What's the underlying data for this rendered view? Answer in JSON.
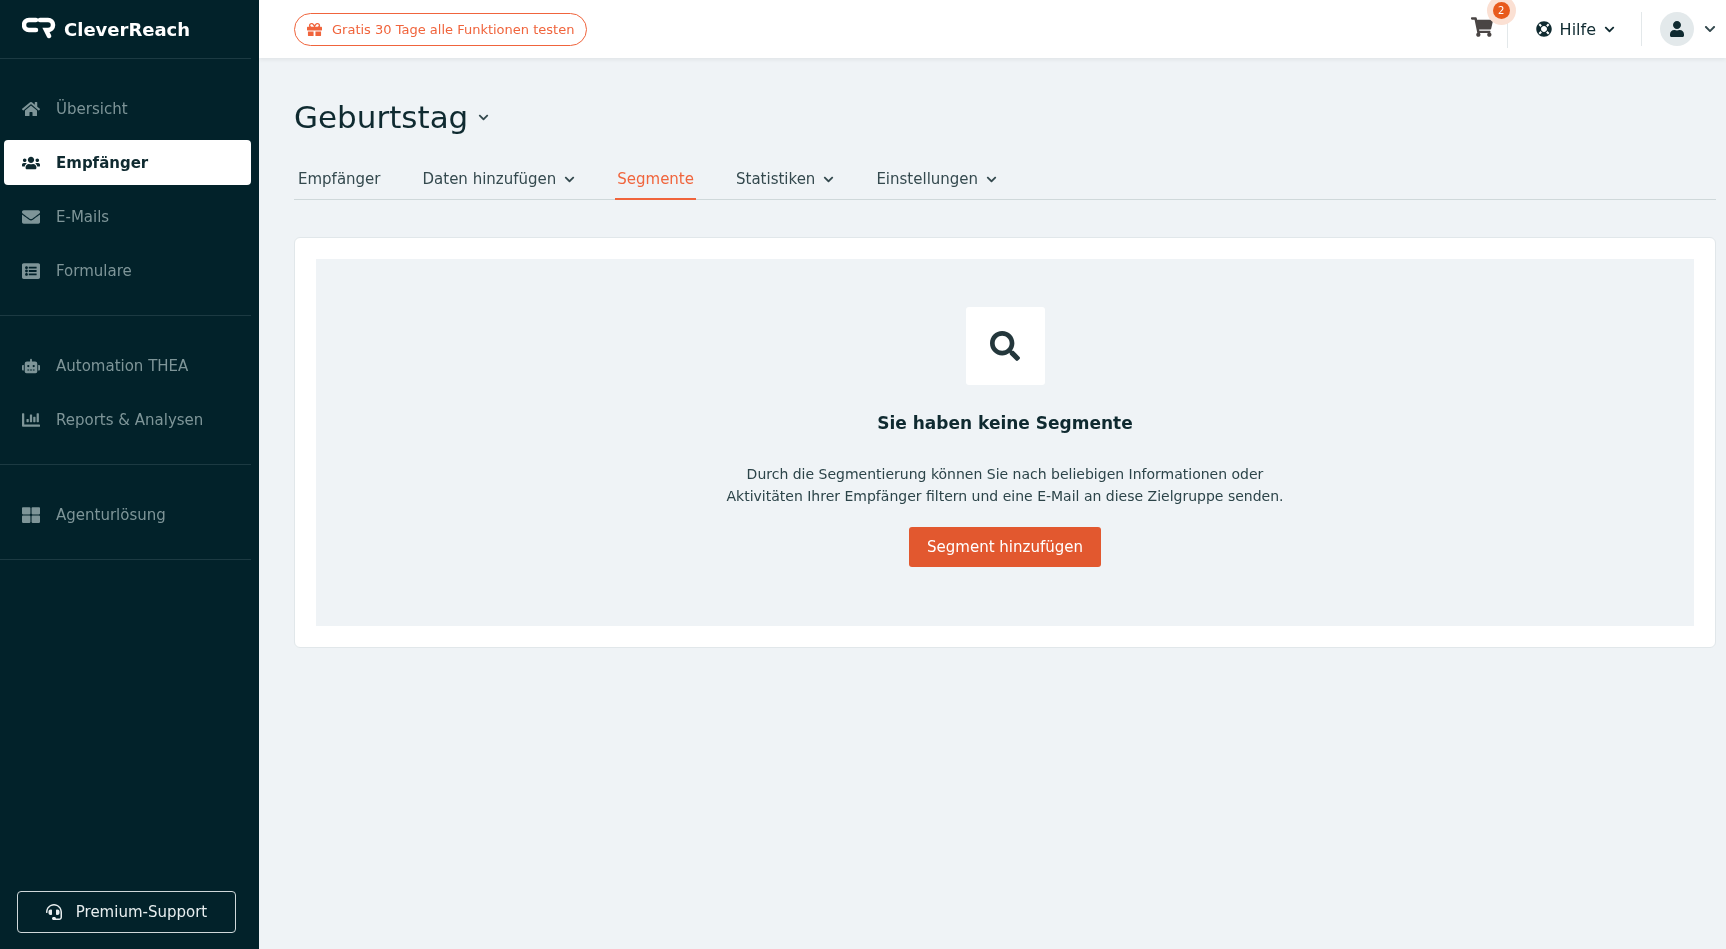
{
  "brand": {
    "name": "CleverReach"
  },
  "sidebar": {
    "groups": [
      {
        "items": [
          {
            "label": "Übersicht",
            "selected": false
          },
          {
            "label": "Empfänger",
            "selected": true
          },
          {
            "label": "E-Mails",
            "selected": false
          },
          {
            "label": "Formulare",
            "selected": false
          }
        ]
      },
      {
        "items": [
          {
            "label": "Automation THEA",
            "selected": false
          },
          {
            "label": "Reports & Analysen",
            "selected": false
          }
        ]
      },
      {
        "items": [
          {
            "label": "Agenturlösung",
            "selected": false
          }
        ]
      }
    ],
    "support_button": "Premium-Support"
  },
  "topbar": {
    "promo": "Gratis 30 Tage alle Funktionen testen",
    "cart_count": "2",
    "help": "Hilfe"
  },
  "page": {
    "title": "Geburtstag",
    "tabs": [
      {
        "label": "Empfänger",
        "selected": false,
        "dropdown": false
      },
      {
        "label": "Daten hinzufügen",
        "selected": false,
        "dropdown": true
      },
      {
        "label": "Segmente",
        "selected": true,
        "dropdown": false
      },
      {
        "label": "Statistiken",
        "selected": false,
        "dropdown": true
      },
      {
        "label": "Einstellungen",
        "selected": false,
        "dropdown": true
      }
    ],
    "empty_state": {
      "heading": "Sie haben keine Segmente",
      "text": "Durch die Segmentierung können Sie nach beliebigen Informationen oder Aktivitäten Ihrer Empfänger filtern und eine E-Mail an diese Zielgruppe senden.",
      "button": "Segment hinzufügen"
    }
  }
}
